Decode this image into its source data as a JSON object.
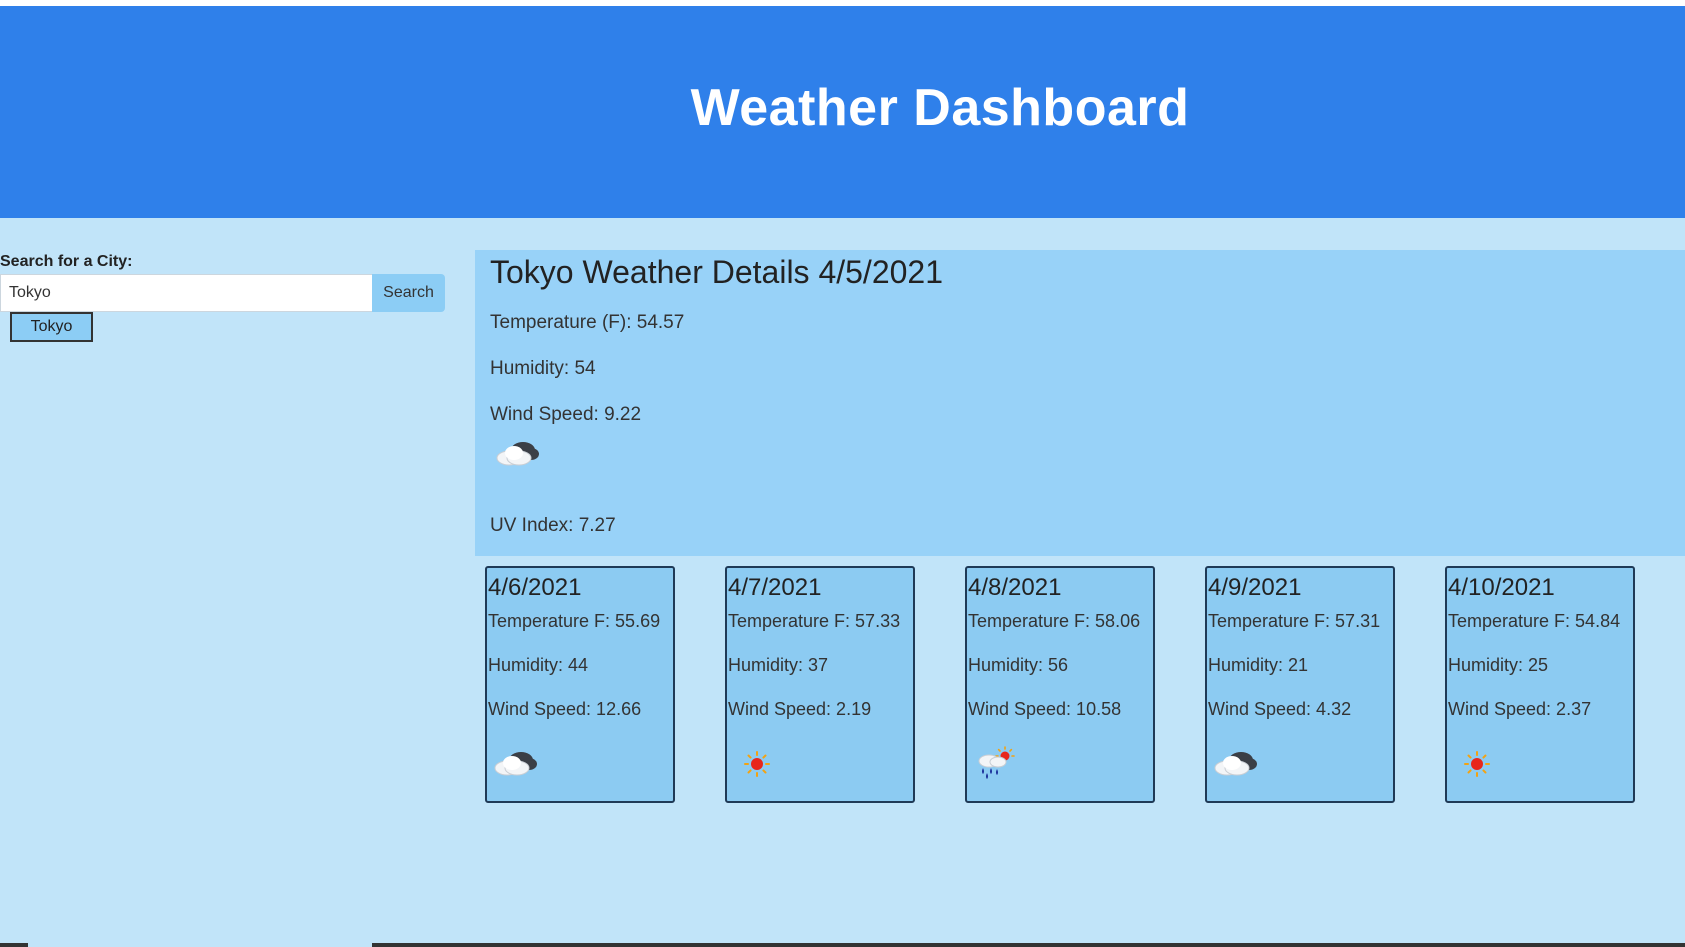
{
  "header": {
    "title": "Weather Dashboard"
  },
  "sidebar": {
    "search_label": "Search for a City:",
    "search_value": "Tokyo",
    "search_button": "Search",
    "history": [
      "Tokyo"
    ]
  },
  "current": {
    "title": "Tokyo Weather Details 4/5/2021",
    "temperature": "Temperature (F): 54.57",
    "humidity": "Humidity: 54",
    "wind": "Wind Speed: 9.22",
    "icon": "cloud-icon",
    "uv": "UV Index: 7.27"
  },
  "forecast": [
    {
      "date": "4/6/2021",
      "temperature": "Temperature F: 55.69",
      "humidity": "Humidity: 44",
      "wind": "Wind Speed: 12.66",
      "icon": "cloud-icon"
    },
    {
      "date": "4/7/2021",
      "temperature": "Temperature F: 57.33",
      "humidity": "Humidity: 37",
      "wind": "Wind Speed: 2.19",
      "icon": "sun-icon"
    },
    {
      "date": "4/8/2021",
      "temperature": "Temperature F: 58.06",
      "humidity": "Humidity: 56",
      "wind": "Wind Speed: 10.58",
      "icon": "rain-sun-icon"
    },
    {
      "date": "4/9/2021",
      "temperature": "Temperature F: 57.31",
      "humidity": "Humidity: 21",
      "wind": "Wind Speed: 4.32",
      "icon": "cloud-icon"
    },
    {
      "date": "4/10/2021",
      "temperature": "Temperature F: 54.84",
      "humidity": "Humidity: 25",
      "wind": "Wind Speed: 2.37",
      "icon": "sun-icon"
    }
  ],
  "colors": {
    "header": "#2f80ea",
    "page": "#c1e4f9",
    "panel": "#98d2f8",
    "card": "#8ccbf2",
    "button": "#8ccdf5"
  }
}
